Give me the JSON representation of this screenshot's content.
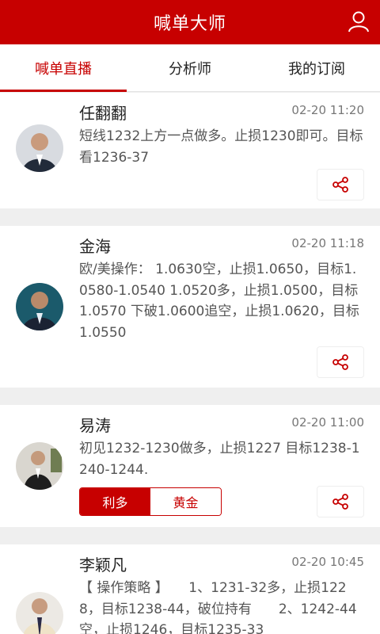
{
  "app": {
    "title": "喊单大师",
    "user_icon": "user-icon"
  },
  "tabs": [
    {
      "label": "喊单直播",
      "active": true
    },
    {
      "label": "分析师",
      "active": false
    },
    {
      "label": "我的订阅",
      "active": false
    }
  ],
  "posts": [
    {
      "author": "任翻翻",
      "time": "02-20 11:20",
      "content": "短线1232上方一点做多。止损1230即可。目标看1236-37",
      "avatar_icon": "avatar-photo",
      "share_icon": "share-icon"
    },
    {
      "author": "金海",
      "time": "02-20 11:18",
      "content": "欧/美操作： 1.0630空，止损1.0650，目标1.0580-1.0540 1.0520多，止损1.0500，目标1.0570 下破1.0600追空，止损1.0620，目标1.0550",
      "avatar_icon": "avatar-photo",
      "share_icon": "share-icon"
    },
    {
      "author": "易涛",
      "time": "02-20 11:00",
      "content": "初见1232-1230做多，止损1227 目标1238-1240-1244.",
      "avatar_icon": "avatar-photo",
      "share_icon": "share-icon",
      "tags": [
        {
          "label": "利多",
          "active": true
        },
        {
          "label": "黄金",
          "active": false
        }
      ]
    },
    {
      "author": "李颖凡",
      "time": "02-20 10:45",
      "content": "【 操作策略 】　　1、1231-32多，止损1228，目标1238-44，破位持有　　2、1242-44空，止损1246，目标1235-33",
      "avatar_icon": "avatar-photo"
    }
  ],
  "colors": {
    "brand": "#c70000"
  }
}
